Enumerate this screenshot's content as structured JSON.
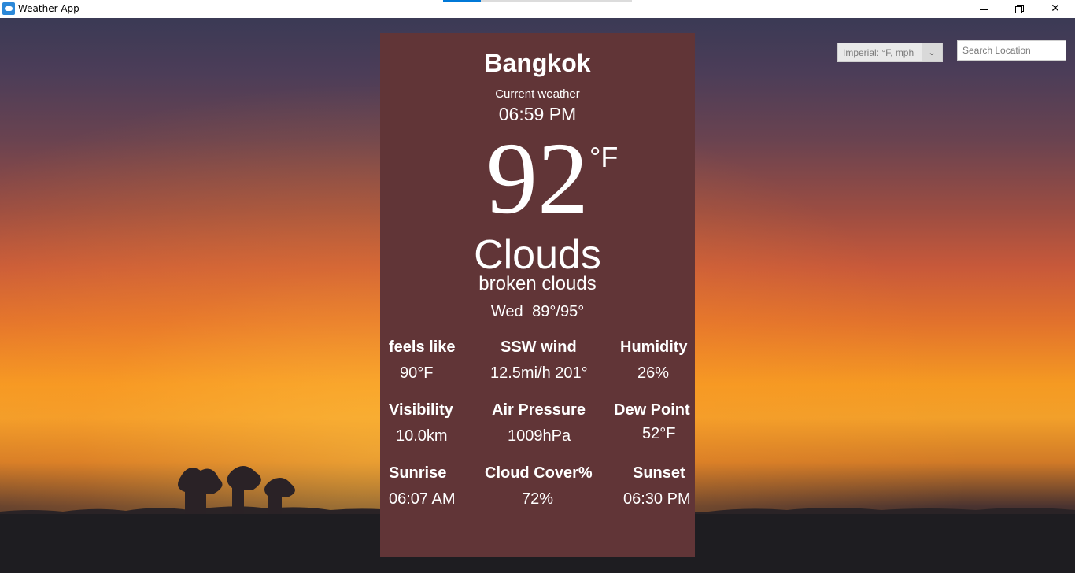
{
  "window": {
    "title": "Weather App"
  },
  "controls": {
    "units_label": "Imperial: °F, mph",
    "search_placeholder": "Search Location"
  },
  "weather": {
    "city": "Bangkok",
    "subtitle": "Current weather",
    "time": "06:59 PM",
    "temperature": "92",
    "temperature_unit": "°F",
    "condition": "Clouds",
    "description": "broken clouds",
    "day": "Wed",
    "range": "89°/95°"
  },
  "stats": {
    "feels_like": {
      "label": "feels like",
      "value": "90°F"
    },
    "wind": {
      "label": "SSW wind",
      "value": "12.5mi/h 201°"
    },
    "humidity": {
      "label": "Humidity",
      "value": "26%"
    },
    "visibility": {
      "label": "Visibility",
      "value": "10.0km"
    },
    "pressure": {
      "label": "Air Pressure",
      "value": "1009hPa"
    },
    "dew_point": {
      "label": "Dew Point",
      "value": "52°F"
    },
    "sunrise": {
      "label": "Sunrise",
      "value": "06:07 AM"
    },
    "cloud_cover": {
      "label": "Cloud Cover%",
      "value": "72%"
    },
    "sunset": {
      "label": "Sunset",
      "value": "06:30 PM"
    }
  }
}
